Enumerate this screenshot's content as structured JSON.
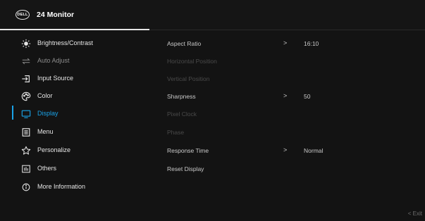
{
  "header": {
    "logo_text": "DELL",
    "model": "24 Monitor"
  },
  "menu": [
    {
      "label": "Brightness/Contrast",
      "icon": "brightness-icon"
    },
    {
      "label": "Auto Adjust",
      "icon": "auto-adjust-icon"
    },
    {
      "label": "Input Source",
      "icon": "input-source-icon"
    },
    {
      "label": "Color",
      "icon": "color-palette-icon"
    },
    {
      "label": "Display",
      "icon": "display-monitor-icon",
      "active": true
    },
    {
      "label": "Menu",
      "icon": "menu-icon"
    },
    {
      "label": "Personalize",
      "icon": "star-icon"
    },
    {
      "label": "Others",
      "icon": "others-icon"
    },
    {
      "label": "More Information",
      "icon": "info-icon"
    }
  ],
  "submenu": [
    {
      "label": "Aspect Ratio",
      "chevron": ">",
      "value": "16:10"
    },
    {
      "label": "Horizontal Position"
    },
    {
      "label": "Vertical Position"
    },
    {
      "label": "Sharpness",
      "chevron": ">",
      "value": "50"
    },
    {
      "label": "Pixel Clock"
    },
    {
      "label": "Phase"
    },
    {
      "label": "Response Time",
      "chevron": ">",
      "value": "Normal"
    },
    {
      "label": "Reset Display"
    }
  ],
  "footer": {
    "exit_label": "< Exit"
  },
  "colors": {
    "accent": "#1aa3e8",
    "background": "#131313",
    "text": "#e6e6e6",
    "dim_text": "#4a4a4a"
  }
}
